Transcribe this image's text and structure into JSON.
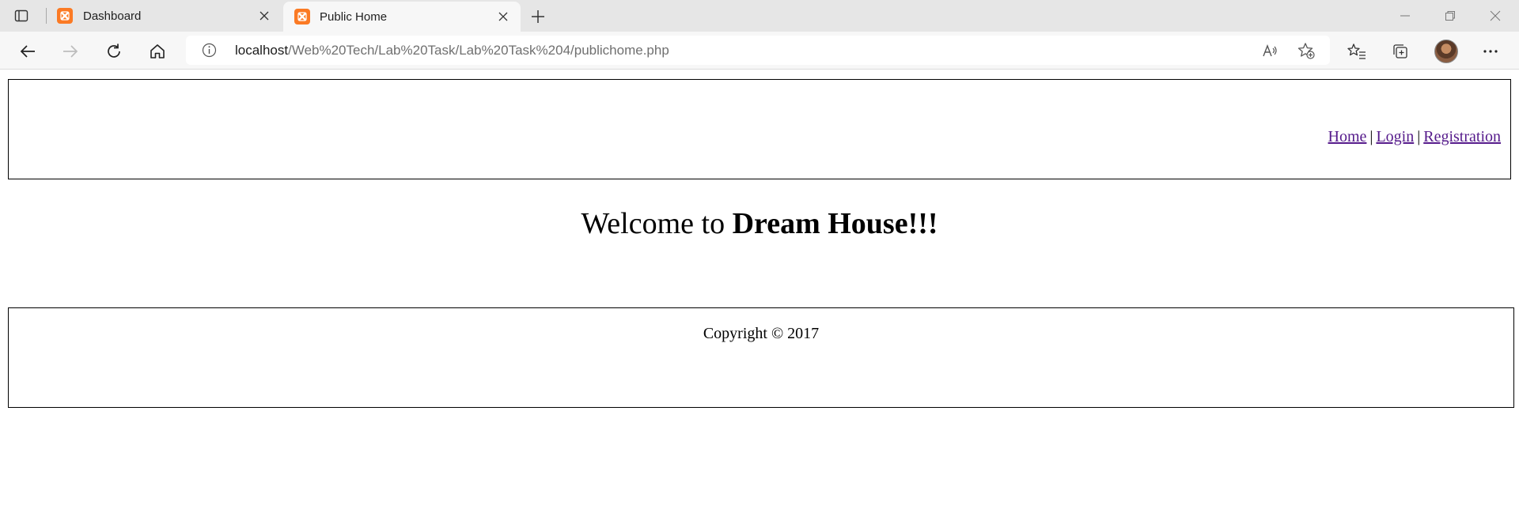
{
  "tabs": [
    {
      "title": "Dashboard",
      "active": false,
      "favicon": "xampp-icon"
    },
    {
      "title": "Public Home",
      "active": true,
      "favicon": "xampp-icon"
    }
  ],
  "address_bar": {
    "host": "localhost",
    "path": "/Web%20Tech/Lab%20Task/Lab%20Task%204/publichome.php"
  },
  "page": {
    "nav": {
      "home": "Home",
      "separator": "|",
      "login": "Login",
      "registration": "Registration"
    },
    "welcome_prefix": "Welcome to",
    "welcome_name": "Dream House!!!",
    "copyright": "Copyright © 2017"
  },
  "colors": {
    "tabbar_bg": "#e6e6e6",
    "toolbar_bg": "#f7f7f7",
    "favicon": "#fb7a24",
    "link_visited": "#551a8b"
  }
}
